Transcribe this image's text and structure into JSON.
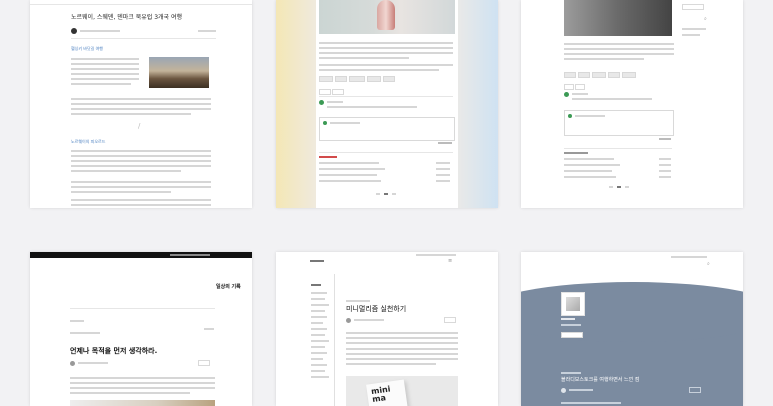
{
  "accent_colors": {
    "blue": "#4a7fc0",
    "green": "#3c9a55",
    "red": "#d24b4b",
    "slate": "#7b8ba0",
    "dark": "#111111"
  },
  "card_a": {
    "post_title": "노르웨이, 스웨덴, 덴마크 북유럽 3개국 여행",
    "section_heading_1": "헬싱키 바닷길 여행",
    "section_heading_2": "노르웨이의 피오르드"
  },
  "card_d": {
    "blog_name": "일상의 기록",
    "post_title": "언제나 목적을 먼저 생각하라."
  },
  "card_e": {
    "post_title": "미니멀리즘 실천하기",
    "image_text": "mini ma"
  },
  "card_f": {
    "post_title": "블라디보스토크를 여행하면서 느낀 점"
  }
}
